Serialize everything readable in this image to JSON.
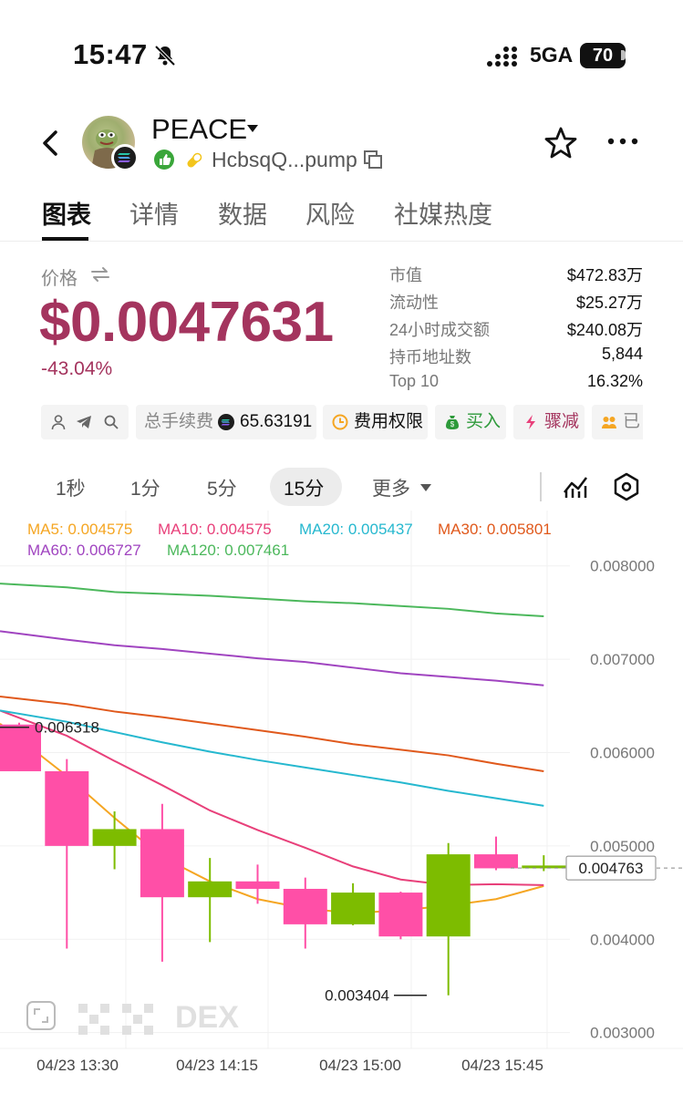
{
  "status_bar": {
    "time": "15:47",
    "network": "5GA",
    "battery": "70"
  },
  "header": {
    "token_name": "PEACE",
    "address": "HcbsqQ...pump"
  },
  "tabs": [
    "图表",
    "详情",
    "数据",
    "风险",
    "社媒热度"
  ],
  "price": {
    "label": "价格",
    "value": "$0.0047631",
    "change": "-43.04%",
    "color": "#a4345e"
  },
  "stats": [
    {
      "label": "市值",
      "value": "$472.83万"
    },
    {
      "label": "流动性",
      "value": "$25.27万"
    },
    {
      "label": "24小时成交额",
      "value": "$240.08万"
    },
    {
      "label": "持币地址数",
      "value": "5,844"
    },
    {
      "label": "Top 10",
      "value": "16.32%"
    }
  ],
  "chips": {
    "fee_label": "总手续费",
    "fee_value": "65.63191",
    "fee_rights": "费用权限",
    "buy": "买入",
    "sell_off": "骤减",
    "truncated": "已"
  },
  "intervals": {
    "items": [
      "1秒",
      "1分",
      "5分",
      "15分",
      "更多"
    ],
    "active": "15分"
  },
  "chart_data": {
    "type": "candlestick",
    "ma_legend": [
      {
        "name": "MA5",
        "text": "MA5: 0.004575",
        "color": "#f5a623"
      },
      {
        "name": "MA10",
        "text": "MA10: 0.004575",
        "color": "#e8407a"
      },
      {
        "name": "MA20",
        "text": "MA20: 0.005437",
        "color": "#26b8cf"
      },
      {
        "name": "MA30",
        "text": "MA30: 0.005801",
        "color": "#e0591c"
      },
      {
        "name": "MA60",
        "text": "MA60: 0.006727",
        "color": "#a044c0"
      },
      {
        "name": "MA120",
        "text": "MA120: 0.007461",
        "color": "#4cb85c"
      }
    ],
    "y_ticks": [
      "0.008000",
      "0.007000",
      "0.006000",
      "0.005000",
      "0.004000",
      "0.003000"
    ],
    "y_tick_values": [
      0.008,
      0.007,
      0.006,
      0.005,
      0.004,
      0.003
    ],
    "ylim": [
      0.00285,
      0.0083
    ],
    "x_labels": [
      "04/23 13:30",
      "04/23 14:15",
      "04/23 15:00",
      "04/23 15:45"
    ],
    "candles": [
      {
        "o": 0.0063,
        "h": 0.00632,
        "l": 0.0058,
        "c": 0.0058
      },
      {
        "o": 0.0058,
        "h": 0.00593,
        "l": 0.0039,
        "c": 0.005
      },
      {
        "o": 0.005,
        "h": 0.00537,
        "l": 0.00475,
        "c": 0.00518
      },
      {
        "o": 0.00518,
        "h": 0.00545,
        "l": 0.00376,
        "c": 0.00445
      },
      {
        "o": 0.00445,
        "h": 0.00487,
        "l": 0.00397,
        "c": 0.00462
      },
      {
        "o": 0.00462,
        "h": 0.0048,
        "l": 0.00438,
        "c": 0.00454
      },
      {
        "o": 0.00454,
        "h": 0.00466,
        "l": 0.0039,
        "c": 0.00416
      },
      {
        "o": 0.00416,
        "h": 0.0046,
        "l": 0.00415,
        "c": 0.0045
      },
      {
        "o": 0.0045,
        "h": 0.00451,
        "l": 0.004,
        "c": 0.00403
      },
      {
        "o": 0.00403,
        "h": 0.00503,
        "l": 0.0034,
        "c": 0.00491
      },
      {
        "o": 0.00491,
        "h": 0.0051,
        "l": 0.00474,
        "c": 0.00476
      },
      {
        "o": 0.00476,
        "h": 0.0049,
        "l": 0.00473,
        "c": 0.00479
      }
    ],
    "ma_lines": {
      "MA5": [
        0.00631,
        0.00575,
        0.0053,
        0.00488,
        0.00462,
        0.00443,
        0.00433,
        0.00428,
        0.00431,
        0.00436,
        0.00443,
        0.00457
      ],
      "MA10": [
        0.00645,
        0.00618,
        0.00591,
        0.00565,
        0.00538,
        0.00517,
        0.00498,
        0.00478,
        0.00464,
        0.00458,
        0.00459,
        0.00458
      ],
      "MA20": [
        0.00645,
        0.00633,
        0.00622,
        0.00611,
        0.00601,
        0.00592,
        0.00584,
        0.00576,
        0.00568,
        0.00559,
        0.00551,
        0.00543
      ],
      "MA30": [
        0.0066,
        0.00652,
        0.00644,
        0.00638,
        0.00631,
        0.00624,
        0.00617,
        0.00609,
        0.00603,
        0.00597,
        0.00588,
        0.0058
      ],
      "MA60": [
        0.0073,
        0.00721,
        0.00715,
        0.00711,
        0.00706,
        0.00701,
        0.00697,
        0.00691,
        0.00685,
        0.00681,
        0.00677,
        0.00672
      ],
      "MA120": [
        0.00781,
        0.00777,
        0.00772,
        0.0077,
        0.00768,
        0.00765,
        0.00762,
        0.0076,
        0.00757,
        0.00754,
        0.00749,
        0.00746
      ]
    },
    "current_price_label": "0.004763",
    "high_annotation": "0.006318",
    "low_annotation": "0.003404",
    "watermark": "DEX",
    "up_color": "#7dbc00",
    "down_color": "#ff4fa7"
  }
}
